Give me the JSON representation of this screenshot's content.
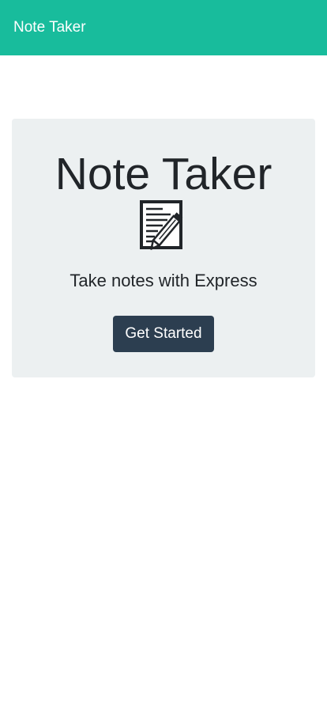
{
  "navbar": {
    "brand": "Note Taker",
    "background_color": "#18bc9c"
  },
  "hero": {
    "title": "Note Taker",
    "icon": "note-with-pencil-icon",
    "subtitle": "Take notes with Express",
    "button_label": "Get Started",
    "background_color": "#ecf0f1",
    "button_color": "#2c3e50"
  }
}
